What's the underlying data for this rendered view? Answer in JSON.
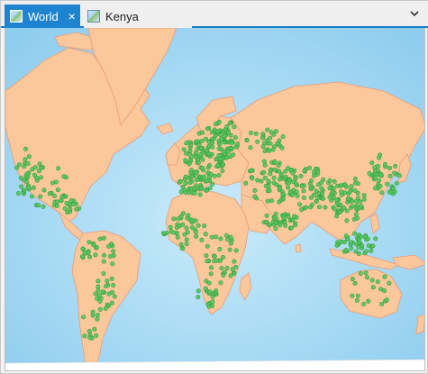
{
  "tabs": [
    {
      "label": "World",
      "active": true,
      "icon": "map-icon"
    },
    {
      "label": "Kenya",
      "active": false,
      "icon": "map-icon"
    }
  ],
  "close_icon": "×",
  "dropdown_icon": "chevron-down-icon",
  "colors": {
    "accent": "#1f84d0",
    "ocean": "#a7d7f2",
    "ocean_light": "#c9ebfb",
    "land": "#fcc89b",
    "land_border": "#e99a75",
    "ice": "#ffffff",
    "point_fill": "#58c45c",
    "point_stroke": "#2f9d3d"
  }
}
